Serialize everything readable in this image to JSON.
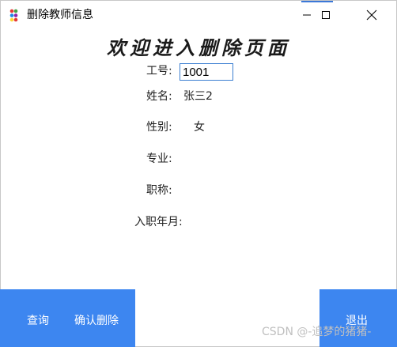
{
  "window": {
    "title": "删除教师信息",
    "icons": {
      "app": "app-dots-icon",
      "minimize": "minimize-icon",
      "maximize": "maximize-icon",
      "close": "close-icon"
    },
    "accent_color": "#3b78d8"
  },
  "heading": "欢迎进入删除页面",
  "form": {
    "id_label": "工号:",
    "id_value": "1001",
    "name_label": "姓名:",
    "name_value": "张三2",
    "gender_label": "性别:",
    "gender_value": "女",
    "major_label": "专业:",
    "major_value": "",
    "title_label": "职称:",
    "title_value": "",
    "hire_label": "入职年月:",
    "hire_value": ""
  },
  "buttons": {
    "query": "查询",
    "confirm_delete": "确认删除",
    "exit": "退出",
    "color": "#3d86f0"
  },
  "watermark": "CSDN @-追梦的猪猪-"
}
